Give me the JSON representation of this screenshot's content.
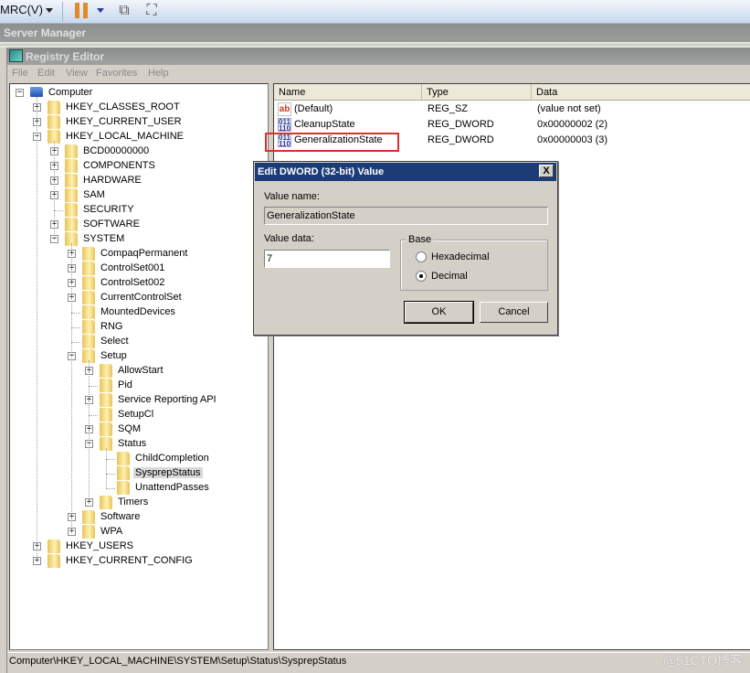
{
  "vm_toolbar": {
    "menu_label": "MRC(V)",
    "icons": [
      "dropdown-arrow",
      "pause-icon",
      "dropdown-arrow",
      "network-icon",
      "fullscreen-icon"
    ]
  },
  "server_manager": {
    "title": "Server Manager"
  },
  "registry_editor": {
    "title": "Registry Editor",
    "menu": [
      "File",
      "Edit",
      "View",
      "Favorites",
      "Help"
    ]
  },
  "tree": {
    "nodes": [
      {
        "label": "Computer",
        "level": 0,
        "expander": "-",
        "icon": "computer"
      },
      {
        "label": "HKEY_CLASSES_ROOT",
        "level": 1,
        "expander": "+"
      },
      {
        "label": "HKEY_CURRENT_USER",
        "level": 1,
        "expander": "+"
      },
      {
        "label": "HKEY_LOCAL_MACHINE",
        "level": 1,
        "expander": "-"
      },
      {
        "label": "BCD00000000",
        "level": 2,
        "expander": "+"
      },
      {
        "label": "COMPONENTS",
        "level": 2,
        "expander": "+"
      },
      {
        "label": "HARDWARE",
        "level": 2,
        "expander": "+"
      },
      {
        "label": "SAM",
        "level": 2,
        "expander": "+"
      },
      {
        "label": "SECURITY",
        "level": 2,
        "expander": ""
      },
      {
        "label": "SOFTWARE",
        "level": 2,
        "expander": "+"
      },
      {
        "label": "SYSTEM",
        "level": 2,
        "expander": "-"
      },
      {
        "label": "CompaqPermanent",
        "level": 3,
        "expander": "+"
      },
      {
        "label": "ControlSet001",
        "level": 3,
        "expander": "+"
      },
      {
        "label": "ControlSet002",
        "level": 3,
        "expander": "+"
      },
      {
        "label": "CurrentControlSet",
        "level": 3,
        "expander": "+"
      },
      {
        "label": "MountedDevices",
        "level": 3,
        "expander": ""
      },
      {
        "label": "RNG",
        "level": 3,
        "expander": ""
      },
      {
        "label": "Select",
        "level": 3,
        "expander": ""
      },
      {
        "label": "Setup",
        "level": 3,
        "expander": "-"
      },
      {
        "label": "AllowStart",
        "level": 4,
        "expander": "+"
      },
      {
        "label": "Pid",
        "level": 4,
        "expander": ""
      },
      {
        "label": "Service Reporting API",
        "level": 4,
        "expander": "+"
      },
      {
        "label": "SetupCl",
        "level": 4,
        "expander": ""
      },
      {
        "label": "SQM",
        "level": 4,
        "expander": "+"
      },
      {
        "label": "Status",
        "level": 4,
        "expander": "-"
      },
      {
        "label": "ChildCompletion",
        "level": 5,
        "expander": ""
      },
      {
        "label": "SysprepStatus",
        "level": 5,
        "expander": "",
        "selected": true
      },
      {
        "label": "UnattendPasses",
        "level": 5,
        "expander": ""
      },
      {
        "label": "Timers",
        "level": 4,
        "expander": "+"
      },
      {
        "label": "Software",
        "level": 3,
        "expander": "+"
      },
      {
        "label": "WPA",
        "level": 3,
        "expander": "+"
      },
      {
        "label": "HKEY_USERS",
        "level": 1,
        "expander": "+"
      },
      {
        "label": "HKEY_CURRENT_CONFIG",
        "level": 1,
        "expander": "+"
      }
    ]
  },
  "values_list": {
    "columns": [
      "Name",
      "Type",
      "Data"
    ],
    "rows": [
      {
        "icon": "string-value-icon",
        "name": "(Default)",
        "type": "REG_SZ",
        "data": "(value not set)"
      },
      {
        "icon": "binary-value-icon",
        "name": "CleanupState",
        "type": "REG_DWORD",
        "data": "0x00000002 (2)"
      },
      {
        "icon": "binary-value-icon",
        "name": "GeneralizationState",
        "type": "REG_DWORD",
        "data": "0x00000003 (3)",
        "highlighted": true
      }
    ],
    "highlight_color": "#d9312c"
  },
  "dialog": {
    "title": "Edit DWORD (32-bit) Value",
    "close_label": "X",
    "value_name_label": "Value name:",
    "value_name": "GeneralizationState",
    "value_data_label": "Value data:",
    "value_data": "7",
    "base_label": "Base",
    "base_options": [
      {
        "label": "Hexadecimal",
        "selected": false
      },
      {
        "label": "Decimal",
        "selected": true
      }
    ],
    "ok_label": "OK",
    "cancel_label": "Cancel"
  },
  "status_bar": {
    "path": "Computer\\HKEY_LOCAL_MACHINE\\SYSTEM\\Setup\\Status\\SysprepStatus"
  },
  "watermark": "@51CTO博客"
}
